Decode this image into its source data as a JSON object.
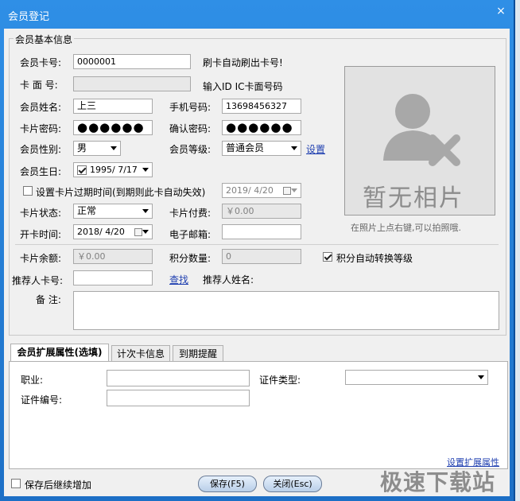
{
  "window": {
    "title": "会员登记",
    "close": "×"
  },
  "basic": {
    "legend": "会员基本信息",
    "card_no": {
      "label": "会员卡号:",
      "value": "0000001",
      "hint": "刷卡自动刷出卡号!"
    },
    "card_face": {
      "label": "卡 面 号:",
      "value": "",
      "hint": "输入ID IC卡面号码"
    },
    "name": {
      "label": "会员姓名:",
      "value": "上三"
    },
    "phone": {
      "label": "手机号码:",
      "value": "13698456327"
    },
    "password": {
      "label": "卡片密码:",
      "value": "●●●●●●"
    },
    "confirm": {
      "label": "确认密码:",
      "value": "●●●●●●"
    },
    "gender": {
      "label": "会员性别:",
      "value": "男"
    },
    "level": {
      "label": "会员等级:",
      "value": "普通会员",
      "link": "设置"
    },
    "birthday": {
      "label": "会员生日:",
      "value": "1995/ 7/17"
    },
    "expire": {
      "label": "设置卡片过期时间(到期则此卡自动失效)",
      "value": "2019/ 4/20"
    },
    "status": {
      "label": "卡片状态:",
      "value": "正常"
    },
    "fee": {
      "label": "卡片付费:",
      "value": "￥0.00"
    },
    "open_date": {
      "label": "开卡时间:",
      "value": "2018/ 4/20"
    },
    "email": {
      "label": "电子邮箱:",
      "value": ""
    },
    "balance": {
      "label": "卡片余额:",
      "value": "￥0.00"
    },
    "points": {
      "label": "积分数量:",
      "value": "0"
    },
    "auto_level": {
      "label": "积分自动转换等级",
      "checked": true
    },
    "referrer": {
      "label": "推荐人卡号:",
      "value": "",
      "link": "查找",
      "name_label": "推荐人姓名:"
    },
    "note": {
      "label": "备 注:",
      "value": ""
    }
  },
  "photo": {
    "placeholder": "暂无相片",
    "hint": "在照片上点右键,可以拍照哦."
  },
  "tabs": [
    {
      "label": "会员扩展属性(选填)",
      "active": true
    },
    {
      "label": "计次卡信息",
      "active": false
    },
    {
      "label": "到期提醒",
      "active": false
    }
  ],
  "ext": {
    "job": {
      "label": "职业:",
      "value": ""
    },
    "id_type": {
      "label": "证件类型:",
      "value": ""
    },
    "id_no": {
      "label": "证件编号:",
      "value": ""
    },
    "set_link": "设置扩展属性"
  },
  "footer": {
    "continue_label": "保存后继续增加",
    "save": "保存(F5)",
    "close": "关闭(Esc)"
  },
  "watermark": "极速下载站",
  "colors": {
    "title_bar": "#2f8fe6",
    "link": "#1f3fb0"
  }
}
